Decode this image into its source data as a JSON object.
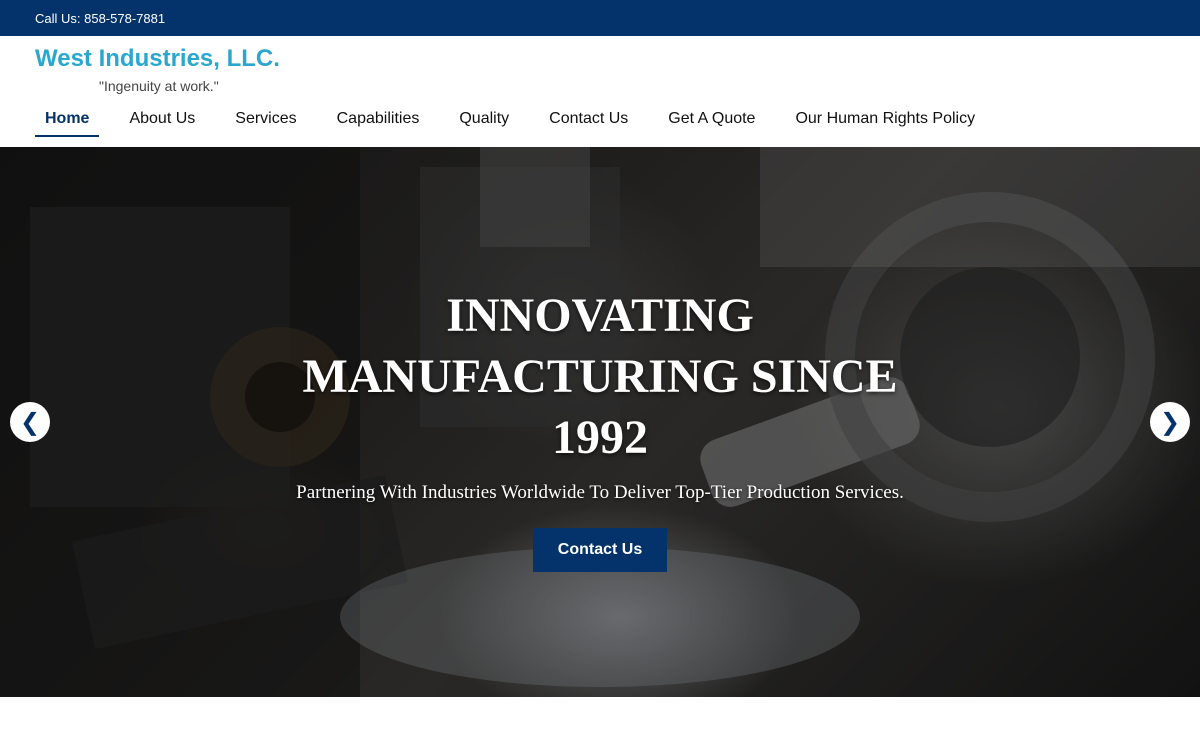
{
  "topbar": {
    "call_text": "Call Us: 858-578-7881"
  },
  "brand": {
    "name": "West Industries, LLC.",
    "tagline": "\"Ingenuity at work.\""
  },
  "nav": {
    "items": [
      {
        "label": "Home",
        "active": true
      },
      {
        "label": "About Us"
      },
      {
        "label": "Services"
      },
      {
        "label": "Capabilities"
      },
      {
        "label": "Quality"
      },
      {
        "label": "Contact Us"
      },
      {
        "label": "Get A Quote"
      },
      {
        "label": "Our Human Rights Policy"
      }
    ]
  },
  "hero": {
    "title": "INNOVATING MANUFACTURING SINCE 1992",
    "subtitle": "Partnering With Industries Worldwide To Deliver Top-Tier Production Services.",
    "button_label": "Contact Us",
    "prev_arrow": "❮",
    "next_arrow": "❯"
  },
  "colors": {
    "primary": "#03336a",
    "brand": "#2aa7cf",
    "white": "#ffffff"
  },
  "icons": {
    "prev": "chevron-left-icon",
    "next": "chevron-right-icon"
  }
}
